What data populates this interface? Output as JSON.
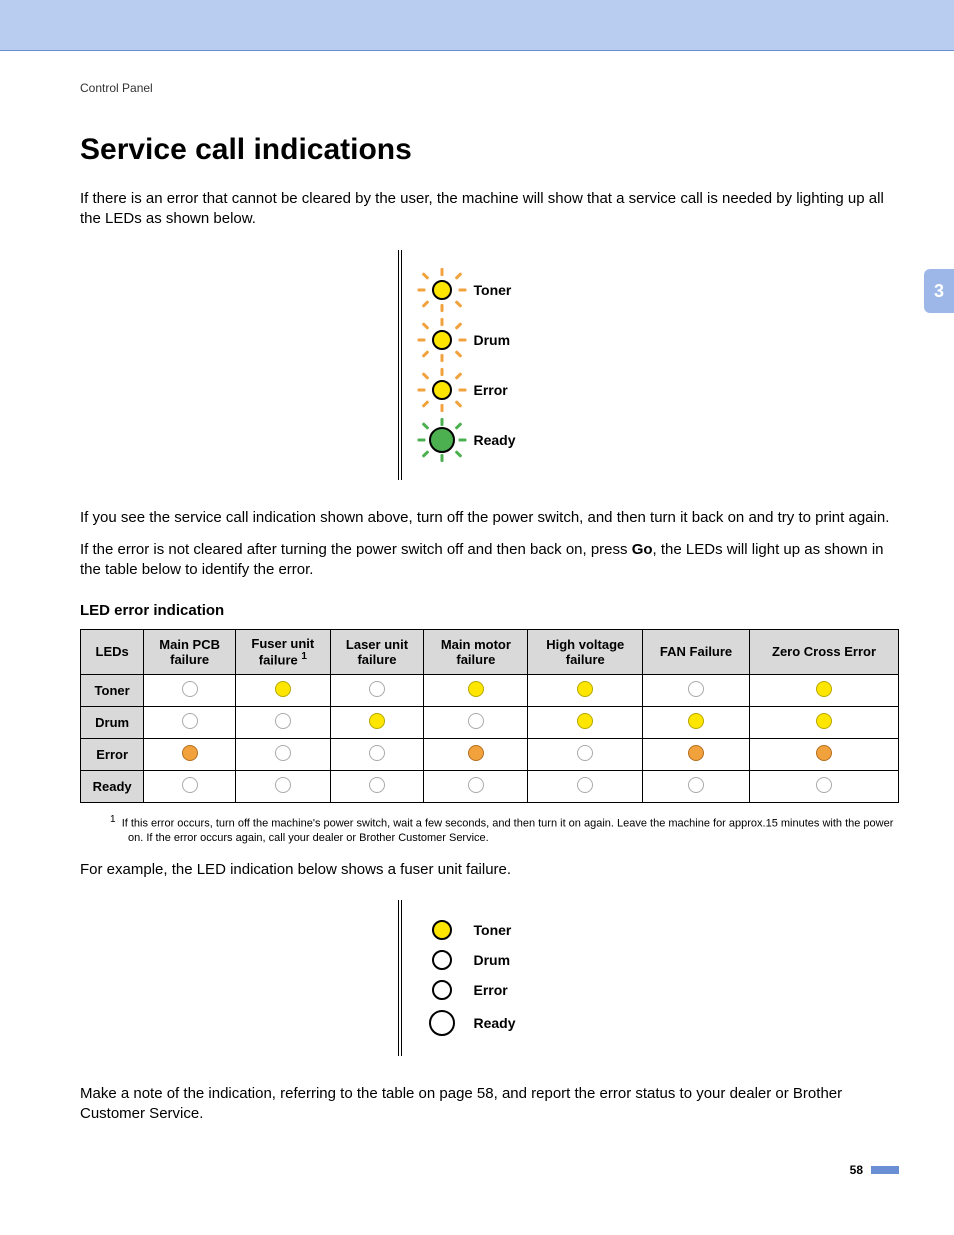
{
  "breadcrumb": "Control Panel",
  "chapter_tab": "3",
  "page_number": "58",
  "heading": "Service call indications",
  "p1": "If there is an error that cannot be cleared by the user, the machine will show that a service call is needed by lighting up all the LEDs as shown below.",
  "p2": "If you see the service call indication shown above, turn off the power switch, and then turn it back on and try to print again.",
  "p3_a": "If the error is not cleared after turning the power switch off and then back on, press ",
  "p3_b": "Go",
  "p3_c": ", the LEDs will light up as shown in the table below to identify the error.",
  "table_title": "LED error indication",
  "footnote_marker": "1",
  "footnote": "If this error occurs, turn off the machine's power switch, wait a few seconds, and then turn it on again. Leave the machine for approx.15 minutes with the power on. If the error occurs again, call your dealer or Brother Customer Service.",
  "p4": "For example, the LED indication below shows a fuser unit failure.",
  "p5": "Make a note of the indication, referring to the table on page 58, and report the error status to your dealer or Brother Customer Service.",
  "led_labels": {
    "toner": "Toner",
    "drum": "Drum",
    "error": "Error",
    "ready": "Ready"
  },
  "table": {
    "cols": [
      "LEDs",
      "Main PCB failure",
      "Fuser unit failure",
      "Laser unit failure",
      "Main motor failure",
      "High voltage failure",
      "FAN Failure",
      "Zero Cross Error"
    ],
    "fuser_footnote_col": 2,
    "rows": [
      {
        "label": "Toner",
        "cells": [
          "off",
          "yellow",
          "off",
          "yellow",
          "yellow",
          "off",
          "yellow"
        ]
      },
      {
        "label": "Drum",
        "cells": [
          "off",
          "off",
          "yellow",
          "off",
          "yellow",
          "yellow",
          "yellow"
        ]
      },
      {
        "label": "Error",
        "cells": [
          "orange",
          "off",
          "off",
          "orange",
          "off",
          "orange",
          "orange"
        ]
      },
      {
        "label": "Ready",
        "cells": [
          "off",
          "off",
          "off",
          "off",
          "off",
          "off",
          "off"
        ]
      }
    ]
  },
  "panel1": [
    {
      "label_key": "toner",
      "color": "yellow",
      "flash": true,
      "flash_color": "o"
    },
    {
      "label_key": "drum",
      "color": "yellow",
      "flash": true,
      "flash_color": "o"
    },
    {
      "label_key": "error",
      "color": "yellow",
      "flash": true,
      "flash_color": "o"
    },
    {
      "label_key": "ready",
      "color": "green",
      "flash": true,
      "flash_color": "g",
      "big": true
    }
  ],
  "panel2": [
    {
      "label_key": "toner",
      "color": "yellow",
      "flash": false
    },
    {
      "label_key": "drum",
      "color": "off",
      "flash": false
    },
    {
      "label_key": "error",
      "color": "off",
      "flash": false
    },
    {
      "label_key": "ready",
      "color": "off",
      "flash": false,
      "big": true
    }
  ]
}
